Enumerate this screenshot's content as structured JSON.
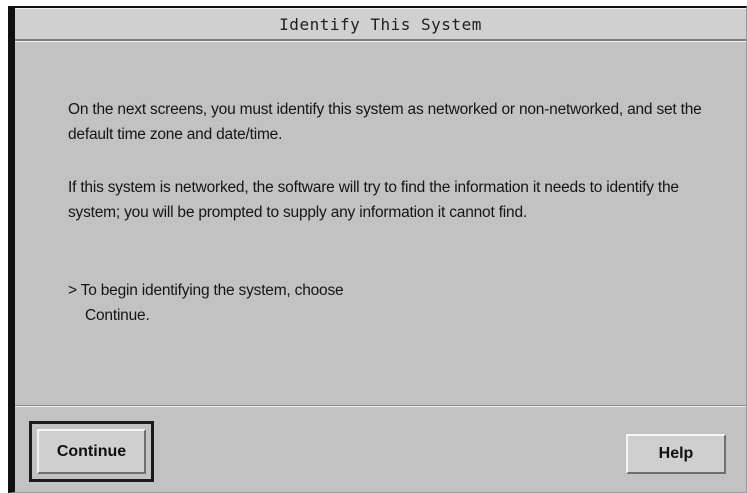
{
  "window": {
    "title": "Identify This System"
  },
  "content": {
    "paragraph1": "On the next screens, you must identify this system as networked or non-networked, and set the default time zone and date/time.",
    "paragraph2": "If this system is networked, the software will try to find the information it needs to identify the system; you will be prompted to supply any information it cannot find.",
    "instruction_line1": "> To begin identifying the system, choose",
    "instruction_line2": "Continue."
  },
  "buttons": {
    "continue_label": "Continue",
    "help_label": "Help"
  }
}
